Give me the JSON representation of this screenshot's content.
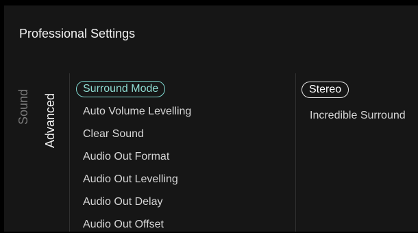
{
  "header": {
    "title": "Professional Settings"
  },
  "tabs": [
    {
      "label": "Sound",
      "active": false
    },
    {
      "label": "Advanced",
      "active": true
    }
  ],
  "menu": {
    "selected_index": 0,
    "items": [
      {
        "label": "Surround Mode"
      },
      {
        "label": "Auto Volume Levelling"
      },
      {
        "label": "Clear Sound"
      },
      {
        "label": "Audio Out Format"
      },
      {
        "label": "Audio Out Levelling"
      },
      {
        "label": "Audio Out Delay"
      },
      {
        "label": "Audio Out Offset"
      }
    ]
  },
  "options": {
    "selected_index": 0,
    "items": [
      {
        "label": "Stereo"
      },
      {
        "label": "Incredible Surround"
      }
    ]
  },
  "colors": {
    "background": "#161616",
    "accent": "#8fdcd2",
    "text": "#d6d6d6",
    "inactive_tab": "#7a7a7a"
  }
}
